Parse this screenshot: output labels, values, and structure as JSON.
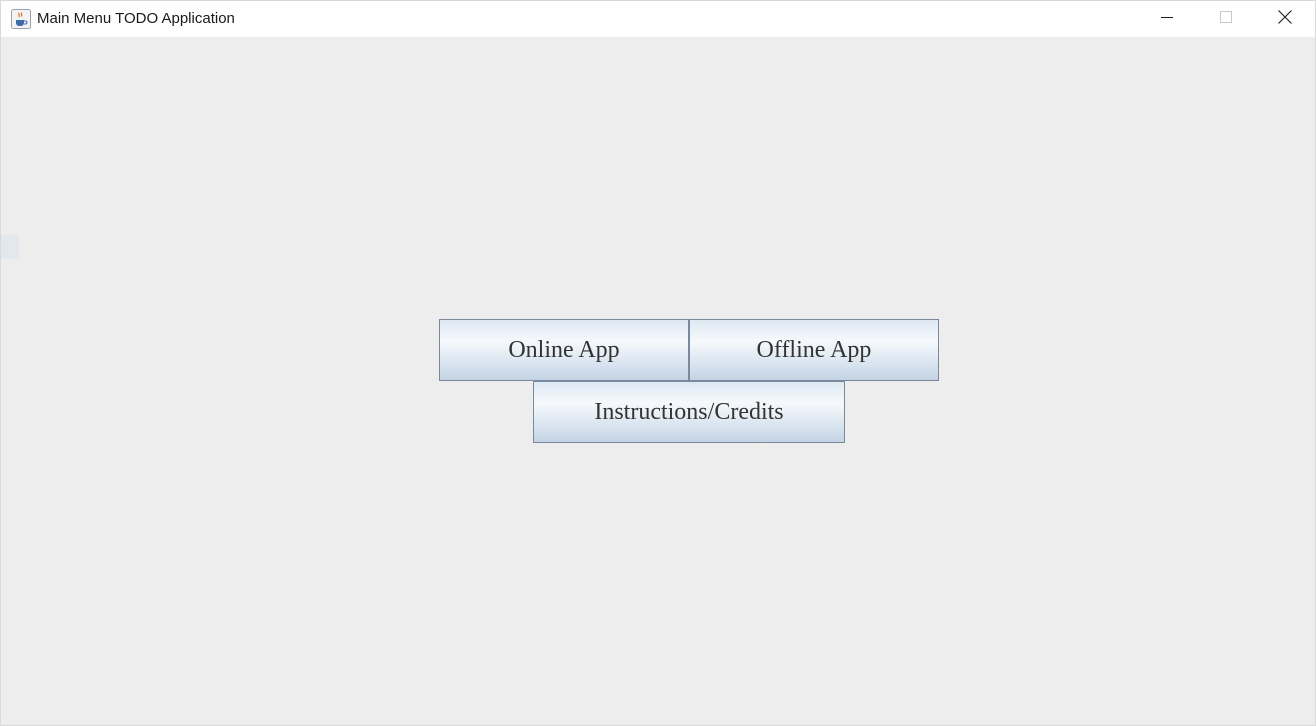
{
  "window": {
    "title": "Main Menu TODO Application",
    "icon": "java-cup-icon",
    "controls": {
      "minimize_icon": "minimize-icon",
      "maximize_icon": "maximize-icon",
      "close_icon": "close-icon"
    }
  },
  "main_menu": {
    "online_label": "Online App",
    "offline_label": "Offline App",
    "instructions_label": "Instructions/Credits"
  },
  "colors": {
    "background": "#ededed",
    "titlebar": "#ffffff",
    "button_border": "#7a8a9c",
    "button_text": "#333333"
  }
}
